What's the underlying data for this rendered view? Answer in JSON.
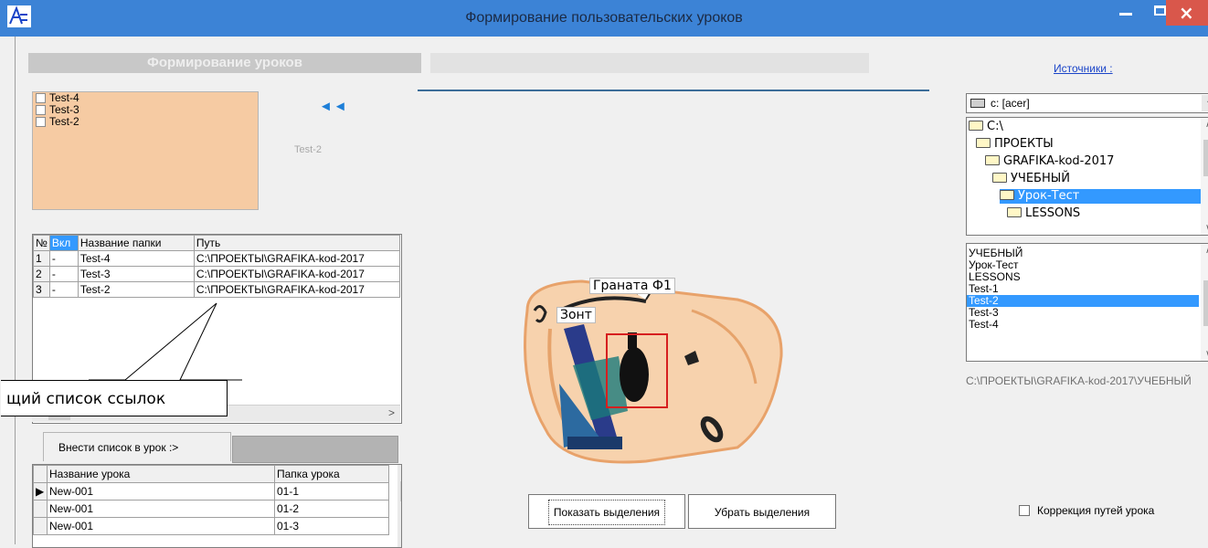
{
  "window": {
    "title": "Формирование пользовательских уроков"
  },
  "left_panel": {
    "header": "Формирование уроков",
    "checklist": [
      "Test-4",
      "Test-3",
      "Test-2"
    ],
    "move_arrows": "◄◄",
    "selected_caption": "Test-2"
  },
  "folders_grid": {
    "columns": [
      "№",
      "Вкл",
      "Название папки",
      "Путь"
    ],
    "rows": [
      [
        "1",
        "-",
        "Test-4",
        "C:\\ПРОЕКТЫ\\GRAFIKA-kod-2017"
      ],
      [
        "2",
        "-",
        "Test-3",
        "C:\\ПРОЕКТЫ\\GRAFIKA-kod-2017"
      ],
      [
        "3",
        "-",
        "Test-2",
        "C:\\ПРОЕКТЫ\\GRAFIKA-kod-2017"
      ]
    ]
  },
  "callout": "щий список ссылок",
  "tabs": {
    "insert_label": "Внести список в урок :>"
  },
  "lessons_grid": {
    "columns": [
      "Название урока",
      "Папка урока"
    ],
    "rows": [
      [
        "New-001",
        "01-1"
      ],
      [
        "New-001",
        "01-2"
      ],
      [
        "New-001",
        "01-3"
      ]
    ]
  },
  "scene": {
    "labels": {
      "grenade": "Граната Ф1",
      "umbrella": "Зонт"
    },
    "highlight_color": "#d61f1f"
  },
  "buttons": {
    "show_selection": "Показать выделения",
    "remove_selection": "Убрать выделения"
  },
  "sources": {
    "link": "Источники :",
    "drive": "c: [acer]",
    "dirs": [
      "C:\\",
      "ПРОЕКТЫ",
      "GRAFIKA-kod-2017",
      "УЧЕБНЫЙ",
      "Урок-Тест",
      "LESSONS"
    ],
    "files": [
      "УЧЕБНЫЙ",
      "Урок-Тест",
      "LESSONS",
      "Test-1",
      "Test-2",
      "Test-3",
      "Test-4"
    ],
    "path": "C:\\ПРОЕКТЫ\\GRAFIKA-kod-2017\\УЧЕБНЫЙ"
  },
  "options": {
    "fix_paths_label": "Коррекция путей урока"
  },
  "colors": {
    "titlebar": "#3c83d6",
    "selection": "#3399ff",
    "checklist_bg": "#f6cba3"
  }
}
